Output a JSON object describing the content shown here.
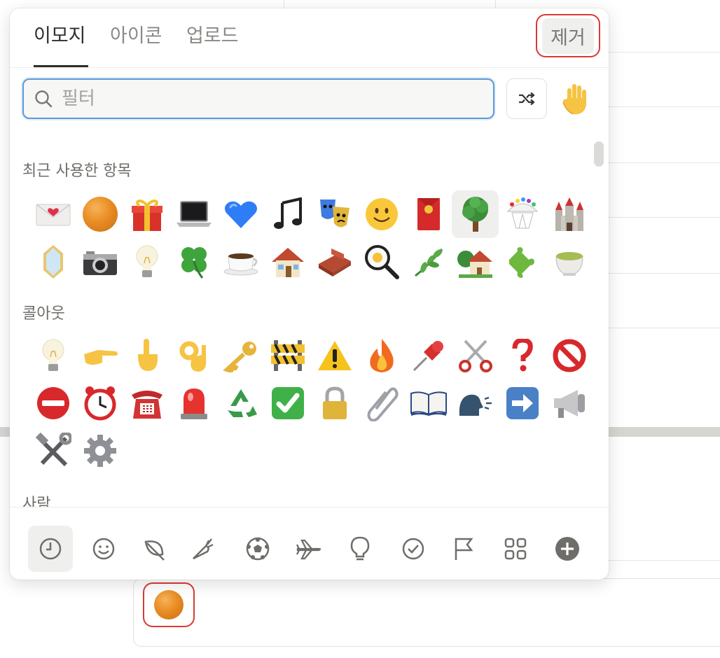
{
  "tabs": [
    {
      "label": "이모지",
      "active": true
    },
    {
      "label": "아이콘",
      "active": false
    },
    {
      "label": "업로드",
      "active": false
    }
  ],
  "remove_label": "제거",
  "search": {
    "placeholder": "필터",
    "value": ""
  },
  "shuffle_icon": "shuffle-icon",
  "skin_tone_icon": "raised-hand-icon",
  "sections": [
    {
      "title": "최근 사용한 항목",
      "items": [
        "love-letter",
        "orange-circle",
        "gift",
        "laptop",
        "blue-heart",
        "musical-notes",
        "performing-arts",
        "smiling-face",
        "red-envelope",
        "deciduous-tree",
        "circus-tent",
        "castle",
        "mirror",
        "camera",
        "light-bulb",
        "four-leaf-clover",
        "hot-beverage",
        "house",
        "bricks",
        "magnifying-glass",
        "herb",
        "house-with-garden",
        "puzzle-piece",
        "teacup"
      ],
      "selected": "deciduous-tree"
    },
    {
      "title": "콜아웃",
      "items": [
        "light-bulb",
        "backhand-index-pointing-right",
        "index-pointing-up",
        "ok-hand",
        "key",
        "construction",
        "warning",
        "fire",
        "pushpin",
        "scissors",
        "question-mark",
        "prohibited",
        "no-entry",
        "alarm-clock",
        "telephone",
        "police-light",
        "recycling-symbol",
        "check-mark-button",
        "locked",
        "paperclip",
        "open-book",
        "speaking-head",
        "right-arrow",
        "loudspeaker",
        "hammer-and-wrench",
        "gear"
      ]
    },
    {
      "title": "사람",
      "items": []
    }
  ],
  "categories": [
    "recent-icon",
    "smiley-icon",
    "leaf-icon",
    "carrot-icon",
    "soccer-icon",
    "airplane-icon",
    "bulb-icon",
    "check-circle-icon",
    "flag-icon",
    "grid-icon",
    "plus-circle-icon"
  ],
  "active_category": "recent-icon",
  "page_icon": "orange-circle"
}
